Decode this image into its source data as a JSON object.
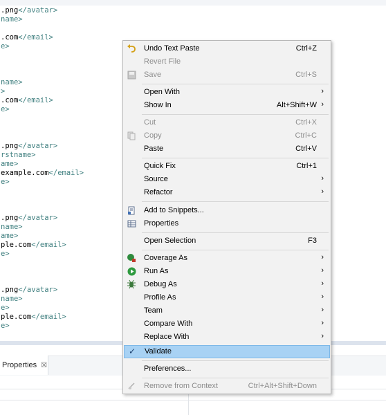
{
  "editor": {
    "lines": [
      {
        "pre": "",
        "text": ".png",
        "close": "</avatar>"
      },
      {
        "pre": "",
        "text": "",
        "close": "name>"
      },
      {
        "pre": "",
        "text": "",
        "close": ""
      },
      {
        "pre": "",
        "text": ".com",
        "close": "</email>"
      },
      {
        "pre": "",
        "text": "",
        "close": "e>"
      },
      {
        "pre": "",
        "text": "",
        "close": "name>"
      },
      {
        "pre": "",
        "text": "",
        "close": ">"
      },
      {
        "pre": "",
        "text": ".com",
        "close": "</email>"
      },
      {
        "pre": "",
        "text": "",
        "close": "e>"
      },
      {
        "pre": "",
        "text": ".png",
        "close": "</avatar>"
      },
      {
        "pre": "",
        "text": "",
        "close": "rstname>"
      },
      {
        "pre": "",
        "text": "",
        "close": "ame>"
      },
      {
        "pre": "",
        "text": "example.com",
        "close": "</email>"
      },
      {
        "pre": "",
        "text": "",
        "close": "e>"
      },
      {
        "pre": "",
        "text": ".png",
        "close": "</avatar>"
      },
      {
        "pre": "",
        "text": "",
        "close": "name>"
      },
      {
        "pre": "",
        "text": "",
        "close": "ame>"
      },
      {
        "pre": "",
        "text": "ple.com",
        "close": "</email>"
      },
      {
        "pre": "",
        "text": "",
        "close": "e>"
      },
      {
        "pre": "",
        "text": ".png",
        "close": "</avatar>"
      },
      {
        "pre": "",
        "text": "",
        "close": "name>"
      },
      {
        "pre": "",
        "text": "",
        "close": "e>"
      },
      {
        "pre": "",
        "text": "ple.com",
        "close": "</email>"
      },
      {
        "pre": "",
        "text": "",
        "close": "e>"
      }
    ]
  },
  "bottom": {
    "tab_label": "Properties",
    "tab_close": "☒"
  },
  "menu": {
    "items": [
      {
        "label": "Undo Text Paste",
        "shortcut": "Ctrl+Z",
        "icon": "undo-icon"
      },
      {
        "label": "Revert File",
        "shortcut": "",
        "disabled": true
      },
      {
        "label": "Save",
        "shortcut": "Ctrl+S",
        "disabled": true,
        "icon": "save-icon"
      },
      {
        "label": "Open With",
        "submenu": true
      },
      {
        "label": "Show In",
        "shortcut": "Alt+Shift+W",
        "submenu": true
      },
      {
        "label": "Cut",
        "shortcut": "Ctrl+X",
        "disabled": true
      },
      {
        "label": "Copy",
        "shortcut": "Ctrl+C",
        "disabled": true,
        "icon": "copy-icon"
      },
      {
        "label": "Paste",
        "shortcut": "Ctrl+V"
      },
      {
        "label": "Quick Fix",
        "shortcut": "Ctrl+1"
      },
      {
        "label": "Source",
        "submenu": true
      },
      {
        "label": "Refactor",
        "submenu": true
      },
      {
        "label": "Add to Snippets...",
        "icon": "snippets-icon"
      },
      {
        "label": "Properties",
        "icon": "properties-icon"
      },
      {
        "label": "Open Selection",
        "shortcut": "F3"
      },
      {
        "label": "Coverage As",
        "submenu": true,
        "icon": "coverage-icon"
      },
      {
        "label": "Run As",
        "submenu": true,
        "icon": "run-icon"
      },
      {
        "label": "Debug As",
        "submenu": true,
        "icon": "debug-icon"
      },
      {
        "label": "Profile As",
        "submenu": true
      },
      {
        "label": "Team",
        "submenu": true
      },
      {
        "label": "Compare With",
        "submenu": true
      },
      {
        "label": "Replace With",
        "submenu": true
      },
      {
        "label": "Validate",
        "checked": true,
        "selected": true,
        "icon": "checkmark-icon"
      },
      {
        "label": "Preferences..."
      },
      {
        "label": "Remove from Context",
        "shortcut": "Ctrl+Alt+Shift+Down",
        "disabled": true,
        "icon": "remove-context-icon"
      }
    ],
    "submenu_arrow": "›",
    "check_glyph": "✓"
  }
}
